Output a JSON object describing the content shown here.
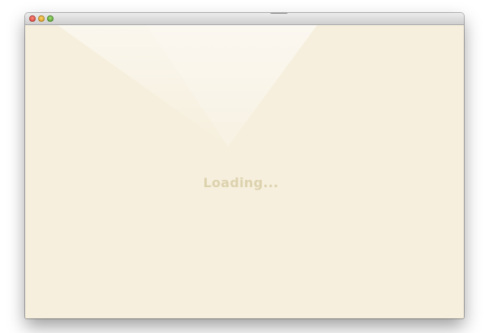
{
  "window": {
    "controls": {
      "close": "close-icon",
      "minimize": "minimize-icon",
      "zoom": "zoom-icon"
    }
  },
  "content": {
    "status_text": "Loading..."
  },
  "colors": {
    "background": "#f6efdd",
    "status_text": "#ddd2ae"
  }
}
